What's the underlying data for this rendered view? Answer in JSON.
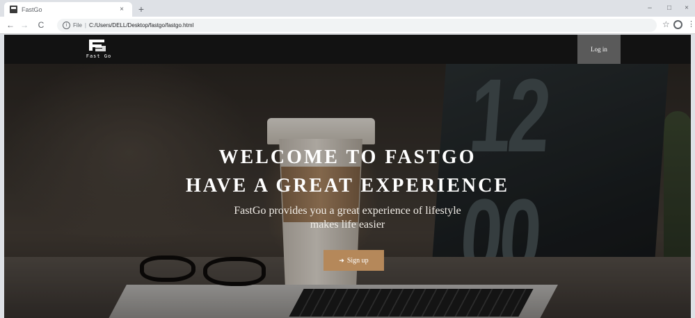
{
  "browser": {
    "tab_title": "FastGo",
    "tab_close": "×",
    "new_tab": "+",
    "nav": {
      "back": "←",
      "forward": "→",
      "reload": "C"
    },
    "url_prefix": "File",
    "url_separator": "|",
    "url": "C:/Users/DELL/Desktop/fastgo/fastgo.html",
    "window": {
      "minimize": "–",
      "maximize": "□",
      "close": "×"
    },
    "icons": {
      "star": "star-icon",
      "profile": "profile-icon",
      "menu": "kebab-menu-icon",
      "info": "info-icon"
    }
  },
  "site": {
    "logo_text": "Fast Go",
    "login_label": "Log in",
    "hero": {
      "title_line1": "WELCOME TO FASTGO",
      "title_line2": "HAVE A GREAT EXPERIENCE",
      "subtitle_line1": "FastGo provides you a great experience of lifestyle",
      "subtitle_line2": "makes life easier"
    },
    "signup_label": "Sign up",
    "signup_icon": "sign-in-icon"
  },
  "colors": {
    "navbar": "#121212",
    "login_button": "#5a5a5a",
    "signup_button": "#b5885a"
  }
}
